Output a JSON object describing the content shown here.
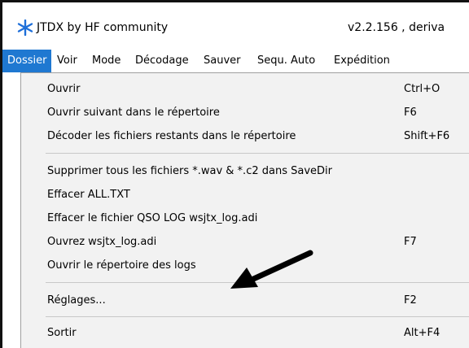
{
  "window": {
    "app_icon": "jtdx-snowflake-icon",
    "title": "JTDX  by HF community",
    "version": "v2.2.156 , deriva"
  },
  "menubar": {
    "items": [
      {
        "label": "Dossier",
        "active": true
      },
      {
        "label": "Voir"
      },
      {
        "label": "Mode"
      },
      {
        "label": "Décodage"
      },
      {
        "label": "Sauver"
      },
      {
        "label": "Sequ. Auto"
      },
      {
        "label": "Expédition"
      }
    ]
  },
  "dropdown": {
    "items": [
      {
        "label": "Ouvrir",
        "shortcut": "Ctrl+O"
      },
      {
        "label": "Ouvrir suivant dans le répertoire",
        "shortcut": "F6"
      },
      {
        "label": "Décoder les fichiers restants dans le répertoire",
        "shortcut": "Shift+F6"
      },
      {
        "label": "Supprimer tous les fichiers *.wav & *.c2 dans SaveDir",
        "shortcut": ""
      },
      {
        "label": "Effacer ALL.TXT",
        "shortcut": ""
      },
      {
        "label": "Effacer le fichier QSO LOG wsjtx_log.adi",
        "shortcut": ""
      },
      {
        "label": "Ouvrez wsjtx_log.adi",
        "shortcut": "F7"
      },
      {
        "label": "Ouvrir le répertoire des logs",
        "shortcut": ""
      },
      {
        "label": "Réglages...",
        "shortcut": "F2"
      },
      {
        "label": "Sortir",
        "shortcut": "Alt+F4"
      }
    ]
  },
  "annotation": {
    "icon": "arrow-pointer-icon",
    "color": "#000000"
  },
  "colors": {
    "menu_active": "#1f78d1",
    "menu_bg": "#f2f2f2",
    "app_icon": "#1e6fd9"
  }
}
